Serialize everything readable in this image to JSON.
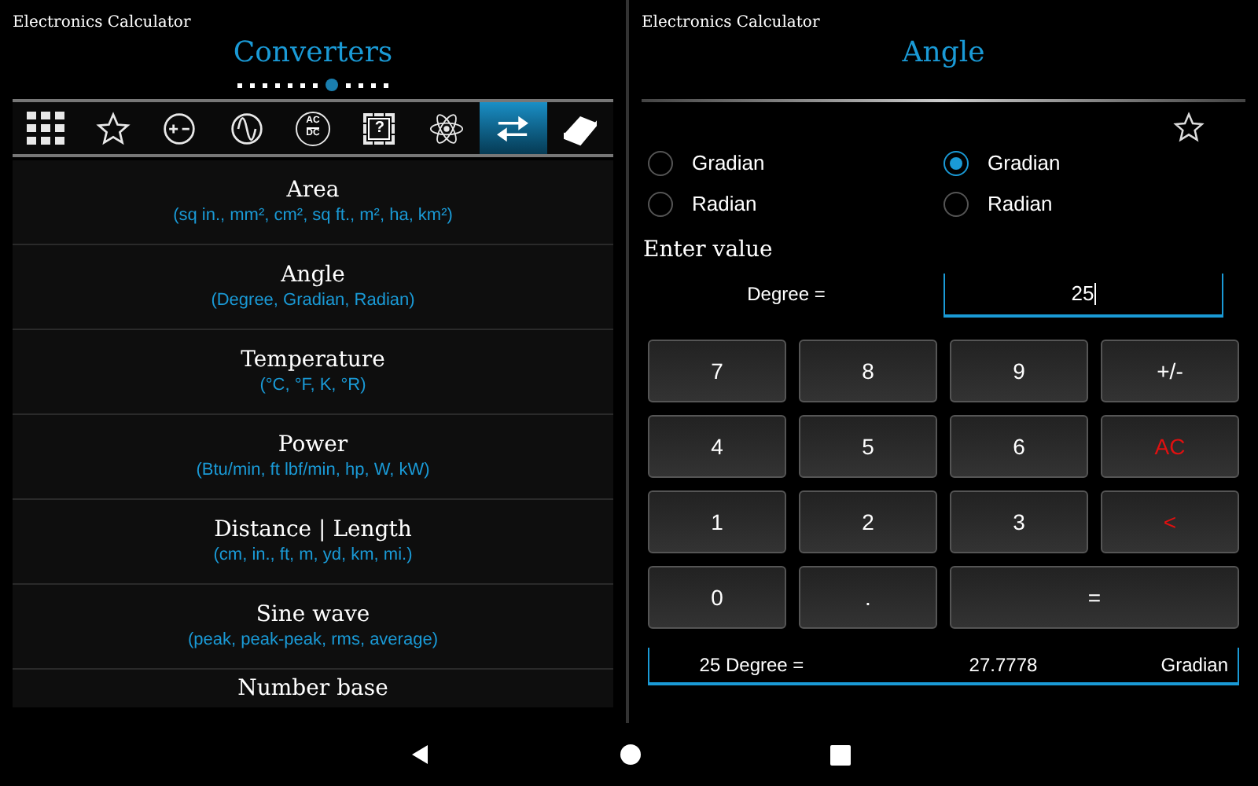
{
  "left": {
    "app_title": "Electronics Calculator",
    "heading": "Converters",
    "pager": [
      {
        "selected": false
      },
      {
        "selected": false
      },
      {
        "selected": false
      },
      {
        "selected": false
      },
      {
        "selected": false
      },
      {
        "selected": false
      },
      {
        "selected": false
      },
      {
        "selected": true
      },
      {
        "selected": false
      },
      {
        "selected": false
      },
      {
        "selected": false
      },
      {
        "selected": false
      }
    ],
    "tabs": [
      {
        "kind": "grid",
        "selected": false
      },
      {
        "kind": "star",
        "selected": false
      },
      {
        "kind": "plusminus",
        "selected": false
      },
      {
        "kind": "sine",
        "selected": false
      },
      {
        "kind": "acdc",
        "top": "AC",
        "bottom": "DC",
        "selected": false
      },
      {
        "kind": "chip",
        "mark": "?",
        "selected": false
      },
      {
        "kind": "atom",
        "selected": false
      },
      {
        "kind": "arrows",
        "selected": true
      },
      {
        "kind": "book",
        "selected": false
      }
    ],
    "items": [
      {
        "title": "Area",
        "units": "(sq in., mm², cm², sq ft., m², ha, km²)"
      },
      {
        "title": "Angle",
        "units": "(Degree, Gradian, Radian)"
      },
      {
        "title": "Temperature",
        "units": "(°C, °F, K, °R)"
      },
      {
        "title": "Power",
        "units": "(Btu/min, ft lbf/min, hp, W, kW)"
      },
      {
        "title": "Distance | Length",
        "units": "(cm, in., ft, m, yd, km, mi.)"
      },
      {
        "title": "Sine wave",
        "units": "(peak, peak-peak, rms, average)"
      },
      {
        "title": "Number base"
      }
    ]
  },
  "right": {
    "app_title": "Electronics Calculator",
    "heading": "Angle",
    "favorite": false,
    "from_units": [
      {
        "label": "Gradian",
        "selected": false
      },
      {
        "label": "Radian",
        "selected": false
      }
    ],
    "to_units": [
      {
        "label": "Gradian",
        "selected": true
      },
      {
        "label": "Radian",
        "selected": false
      }
    ],
    "enter_label": "Enter value",
    "input_label": "Degree =",
    "input_value": "25",
    "keys": [
      {
        "label": "7",
        "kind": "normal"
      },
      {
        "label": "8",
        "kind": "normal"
      },
      {
        "label": "9",
        "kind": "normal"
      },
      {
        "label": "+/-",
        "kind": "normal"
      },
      {
        "label": "4",
        "kind": "normal"
      },
      {
        "label": "5",
        "kind": "normal"
      },
      {
        "label": "6",
        "kind": "normal"
      },
      {
        "label": "AC",
        "kind": "danger"
      },
      {
        "label": "1",
        "kind": "normal"
      },
      {
        "label": "2",
        "kind": "normal"
      },
      {
        "label": "3",
        "kind": "normal"
      },
      {
        "label": "<",
        "kind": "danger"
      },
      {
        "label": "0",
        "kind": "normal"
      },
      {
        "label": ".",
        "kind": "normal"
      },
      {
        "label": "=",
        "kind": "wide"
      }
    ],
    "result": {
      "input": "25 Degree =",
      "value": "27.7778",
      "unit": "Gradian"
    }
  }
}
